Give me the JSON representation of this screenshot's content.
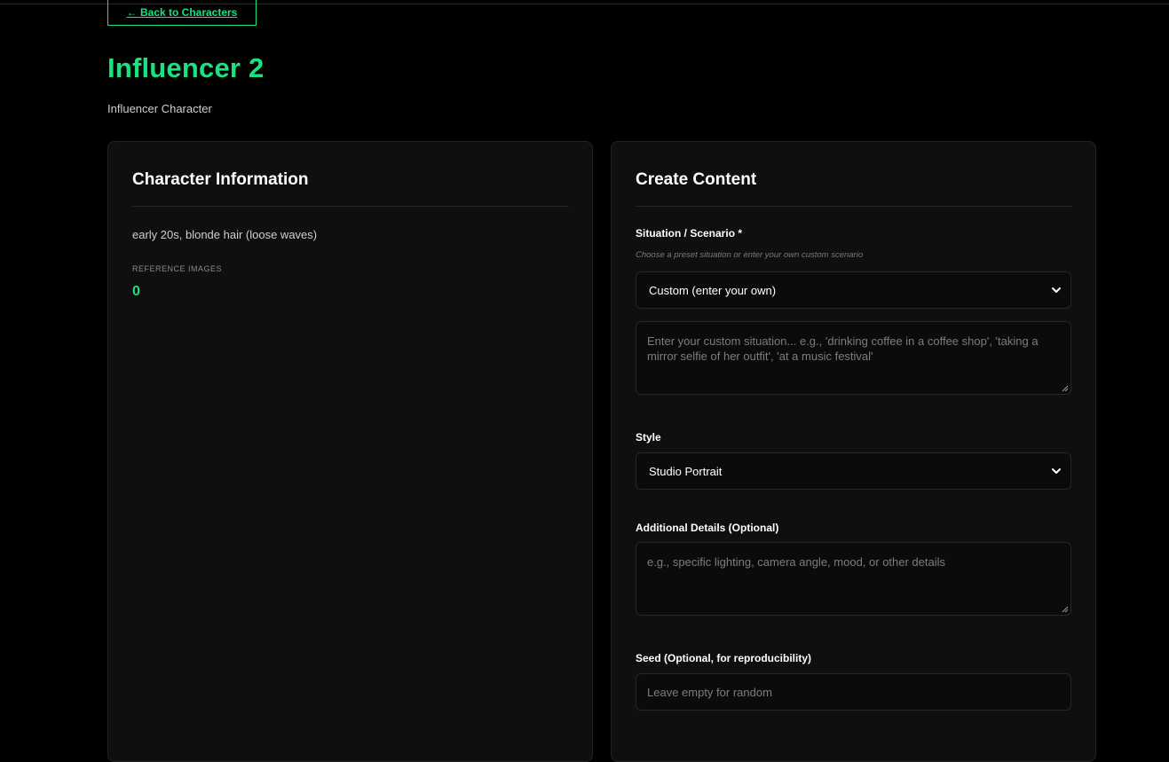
{
  "nav": {
    "back_label": "← Back to Characters"
  },
  "header": {
    "title": "Influencer 2",
    "subtitle": "Influencer Character"
  },
  "character_info": {
    "title": "Character Information",
    "description": "early 20s, blonde hair (loose waves)",
    "reference_images_label": "REFERENCE IMAGES",
    "reference_images_count": "0"
  },
  "create_content": {
    "title": "Create Content",
    "situation": {
      "label": "Situation / Scenario *",
      "hint": "Choose a preset situation or enter your own custom scenario",
      "selected": "Custom (enter your own)",
      "custom_placeholder": "Enter your custom situation... e.g., 'drinking coffee in a coffee shop', 'taking a mirror selfie of her outfit', 'at a music festival'"
    },
    "style": {
      "label": "Style",
      "selected": "Studio Portrait"
    },
    "additional_details": {
      "label": "Additional Details (Optional)",
      "placeholder": "e.g., specific lighting, camera angle, mood, or other details"
    },
    "seed": {
      "label": "Seed (Optional, for reproducibility)",
      "placeholder": "Leave empty for random"
    }
  },
  "colors": {
    "accent": "#17e37f",
    "background": "#000000",
    "card": "#0f0f0f"
  },
  "icons": {
    "select_arrow": "chevron-down-icon",
    "textarea_resize": "resize-grip-icon"
  }
}
